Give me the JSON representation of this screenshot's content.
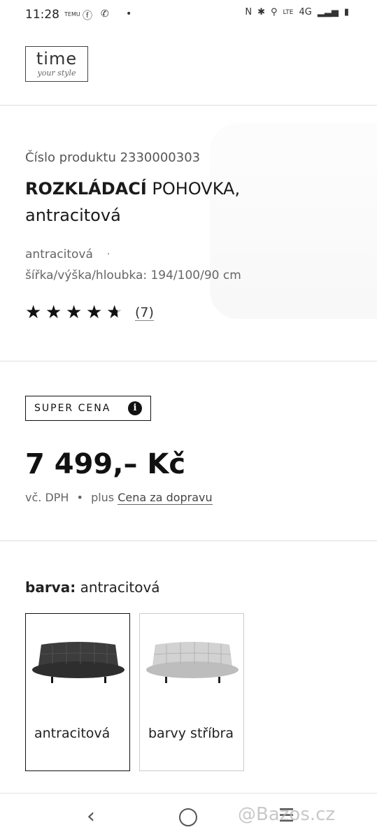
{
  "status_bar": {
    "time": "11:28",
    "network": "4G",
    "temu_text": "TEMU"
  },
  "logo": {
    "main": "time",
    "sub": "your style"
  },
  "product": {
    "number": "Číslo produktu 2330000303",
    "title_bold": "ROZKLÁDACÍ",
    "title_rest": " POHOVKA, antracitová",
    "variant": "antracitová",
    "dimensions": "šířka/výška/hloubka: 194/100/90 cm",
    "rating": 4.5,
    "reviews": "(7)"
  },
  "price_section": {
    "badge": "SUPER CENA",
    "badge_icon": "info-icon",
    "price": "7 499,– Kč",
    "vat": "vč. DPH",
    "separator": "•",
    "plus": "plus",
    "shipping_link": "Cena za dopravu"
  },
  "color_section": {
    "label": "barva:",
    "selected": "antracitová",
    "options": [
      {
        "name": "antracitová",
        "color": "#3c3c3c",
        "selected": true
      },
      {
        "name": "barvy stříbra",
        "color": "#c9c9c9",
        "selected": false
      }
    ]
  },
  "nav": {
    "watermark": "@Bazos.cz"
  }
}
